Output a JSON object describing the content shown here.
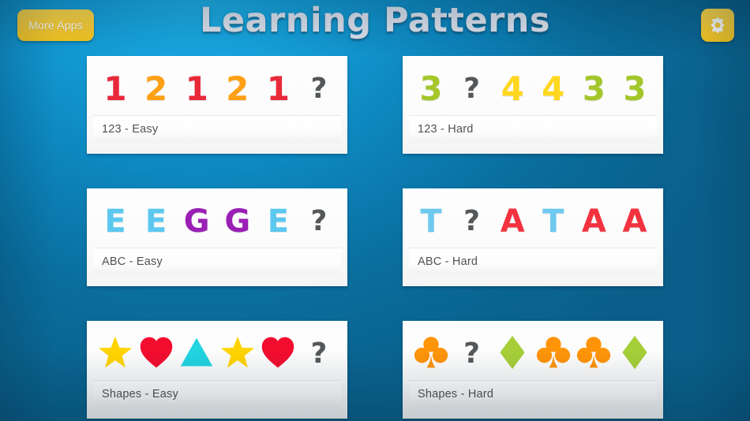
{
  "header": {
    "title": "Learning Patterns",
    "more_apps_label": "More Apps",
    "settings_icon": "gear-icon",
    "button_color": "#fdcf36",
    "title_color": "#dfe4ef"
  },
  "background": {
    "top_left_color": "#23b9ef",
    "edge_color": "#0a5f8a"
  },
  "question_mark": "?",
  "cards": [
    {
      "id": "123-easy",
      "label": "123 - Easy",
      "kind": "numbers",
      "items": [
        {
          "type": "number",
          "value": "1",
          "color": "#e8293a"
        },
        {
          "type": "number",
          "value": "2",
          "color": "#ffa014"
        },
        {
          "type": "number",
          "value": "1",
          "color": "#e8293a"
        },
        {
          "type": "number",
          "value": "2",
          "color": "#ffa014"
        },
        {
          "type": "number",
          "value": "1",
          "color": "#e8293a"
        },
        {
          "type": "question",
          "value": "?",
          "color": "#55585a"
        }
      ]
    },
    {
      "id": "123-hard",
      "label": "123 - Hard",
      "kind": "numbers",
      "items": [
        {
          "type": "number",
          "value": "3",
          "color": "#a3c72b"
        },
        {
          "type": "question",
          "value": "?",
          "color": "#55585a"
        },
        {
          "type": "number",
          "value": "4",
          "color": "#ffd71e"
        },
        {
          "type": "number",
          "value": "4",
          "color": "#ffd71e"
        },
        {
          "type": "number",
          "value": "3",
          "color": "#a3c72b"
        },
        {
          "type": "number",
          "value": "3",
          "color": "#a3c72b"
        }
      ]
    },
    {
      "id": "abc-easy",
      "label": "ABC - Easy",
      "kind": "letters",
      "items": [
        {
          "type": "letter",
          "value": "E",
          "color": "#5cc8f0"
        },
        {
          "type": "letter",
          "value": "E",
          "color": "#5cc8f0"
        },
        {
          "type": "letter",
          "value": "G",
          "color": "#9a1fb5"
        },
        {
          "type": "letter",
          "value": "G",
          "color": "#9a1fb5"
        },
        {
          "type": "letter",
          "value": "E",
          "color": "#5cc8f0"
        },
        {
          "type": "question",
          "value": "?",
          "color": "#55585a"
        }
      ]
    },
    {
      "id": "abc-hard",
      "label": "ABC - Hard",
      "kind": "letters",
      "items": [
        {
          "type": "letter",
          "value": "T",
          "color": "#6ec9ef"
        },
        {
          "type": "question",
          "value": "?",
          "color": "#55585a"
        },
        {
          "type": "letter",
          "value": "A",
          "color": "#f4323f"
        },
        {
          "type": "letter",
          "value": "T",
          "color": "#6ec9ef"
        },
        {
          "type": "letter",
          "value": "A",
          "color": "#f4323f"
        },
        {
          "type": "letter",
          "value": "A",
          "color": "#f4323f"
        }
      ]
    },
    {
      "id": "shapes-easy",
      "label": "Shapes - Easy",
      "kind": "shapes",
      "items": [
        {
          "type": "shape",
          "value": "star",
          "color": "#ffd400"
        },
        {
          "type": "shape",
          "value": "heart",
          "color": "#f20d2f"
        },
        {
          "type": "shape",
          "value": "triangle",
          "color": "#22d3e0"
        },
        {
          "type": "shape",
          "value": "star",
          "color": "#ffd400"
        },
        {
          "type": "shape",
          "value": "heart",
          "color": "#f20d2f"
        },
        {
          "type": "question",
          "value": "?",
          "color": "#55585a"
        }
      ]
    },
    {
      "id": "shapes-hard",
      "label": "Shapes - Hard",
      "kind": "shapes",
      "items": [
        {
          "type": "shape",
          "value": "club",
          "color": "#ff9408"
        },
        {
          "type": "question",
          "value": "?",
          "color": "#55585a"
        },
        {
          "type": "shape",
          "value": "diamond",
          "color": "#a6ce39"
        },
        {
          "type": "shape",
          "value": "club",
          "color": "#ff9408"
        },
        {
          "type": "shape",
          "value": "club",
          "color": "#ff9408"
        },
        {
          "type": "shape",
          "value": "diamond",
          "color": "#a6ce39"
        }
      ]
    }
  ]
}
